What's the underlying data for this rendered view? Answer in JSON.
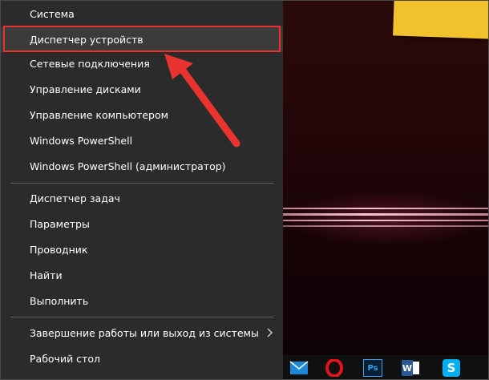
{
  "menu": {
    "items": [
      {
        "label": "Система"
      },
      {
        "label": "Диспетчер устройств"
      },
      {
        "label": "Сетевые подключения"
      },
      {
        "label": "Управление дисками"
      },
      {
        "label": "Управление компьютером"
      },
      {
        "label": "Windows PowerShell"
      },
      {
        "label": "Windows PowerShell (администратор)"
      },
      {
        "label": "Диспетчер задач"
      },
      {
        "label": "Параметры"
      },
      {
        "label": "Проводник"
      },
      {
        "label": "Найти"
      },
      {
        "label": "Выполнить"
      },
      {
        "label": "Завершение работы или выход из системы",
        "has_submenu": true
      },
      {
        "label": "Рабочий стол"
      }
    ],
    "selected_item": "Диспетчер устройств"
  },
  "annotation": {
    "highlight_color": "#e8332f",
    "arrow_color": "#e8332f",
    "target": "Диспетчер устройств"
  },
  "taskbar": {
    "icons": [
      "mail-icon",
      "opera-icon",
      "photoshop-icon",
      "word-icon",
      "skype-icon"
    ],
    "labels": {
      "photoshop": "Ps",
      "word": "W",
      "skype": "S"
    }
  },
  "colors": {
    "menu_bg": "#2b2b2b",
    "menu_text": "#ffffff",
    "wallpaper_accent": "#f2c22c"
  }
}
